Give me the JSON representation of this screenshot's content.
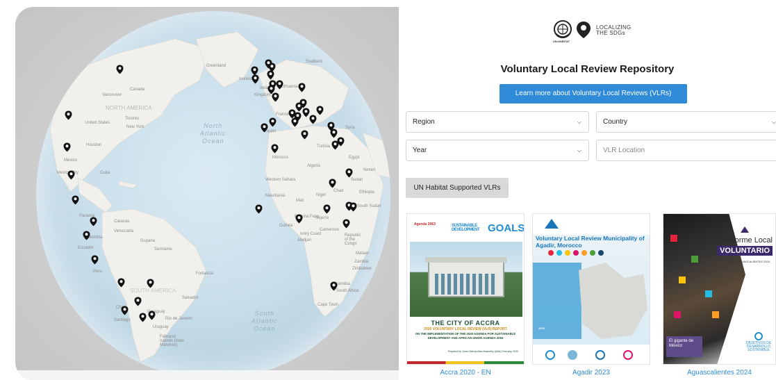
{
  "map": {
    "ocean_north_atlantic": "North\nAtlantic\nOcean",
    "ocean_south_atlantic": "South\nAtlantic\nOcean",
    "labels": [
      "Greenland",
      "Iceland",
      "Svalbard",
      "Canada",
      "Vancouver",
      "NORTH AMERICA",
      "Toronto",
      "New York",
      "United States",
      "Houston",
      "Mexico City",
      "Mexico",
      "Cuba",
      "Caracas",
      "Panama",
      "Colombia",
      "Venezuela",
      "Ecuador",
      "Guyana",
      "Suriname",
      "Peru",
      "SOUTH AMERICA",
      "Fortaleza",
      "Salvador",
      "Chile",
      "Paraguay",
      "Santiago",
      "Uruguay",
      "Rio de Janeiro",
      "Falkland Islands (Islas Malvinas)",
      "Kingdom",
      "Lithuania",
      "France",
      "Spain",
      "Morocco",
      "Algeria",
      "Western Sahara",
      "Mauritania",
      "Mali",
      "Niger",
      "Chad",
      "Sudan",
      "Egypt",
      "Yemen",
      "Ethiopia",
      "South Sudan",
      "Burkina Faso",
      "Nigeria",
      "Guinea",
      "Ivory Coast",
      "Abidjan",
      "Cameroon",
      "Republic of the Congo",
      "Malawi",
      "Zimbabwe",
      "Zambia",
      "Namibia",
      "South Africa",
      "Cape Town",
      "Tunisia",
      "Syria",
      "Ireland"
    ]
  },
  "header": {
    "logo_caption": "UN-HABITAT",
    "logo_text_line1": "LOCALIZING",
    "logo_text_line2": "THE SDGs"
  },
  "repo": {
    "title": "Voluntary Local Review Repository",
    "learn_button": "Learn more about Voluntary Local Reviews (VLRs)"
  },
  "filters": {
    "region": "Region",
    "country": "Country",
    "year": "Year",
    "location_placeholder": "VLR Location",
    "un_supported": "UN Habitat Supported VLRs"
  },
  "cards": [
    {
      "caption": "Accra 2020 - EN",
      "agenda": "Agenda 2063",
      "sdg_top": "SUSTAINABLE",
      "sdg_mid": "DEVELOPMENT",
      "sdg_goals": "GOALS",
      "title": "THE CITY OF ACCRA",
      "subtitle": "2020 VOLUNTARY LOCAL REVIEW (VLR) REPORT",
      "body": "ON THE IMPLEMENTATION OF THE 2030 AGENDA FOR SUSTAINABLE DEVELOPMENT AND AFRICAN UNION AGENDA 2063",
      "prepared": "Prepared by: Accra Metropolitan Assembly (AMA) February, 2020"
    },
    {
      "caption": "Agadir 2023",
      "title": "Voluntary Local Review Municipality of Agadir, Morocco",
      "year": "2023"
    },
    {
      "caption": "Aguascalientes 2024",
      "informe": "Informe Local",
      "voluntario": "VOLUNTARIO",
      "sub": "AGUASCALIENTES 2024",
      "gigante": "El gigante de México",
      "ods": "OBJETIVOS DE DESARROLLO SOSTENIBLE"
    }
  ],
  "colors": {
    "accent_blue": "#2f8ad8",
    "pin": "#111111",
    "button_gray": "#d9d9d9"
  }
}
